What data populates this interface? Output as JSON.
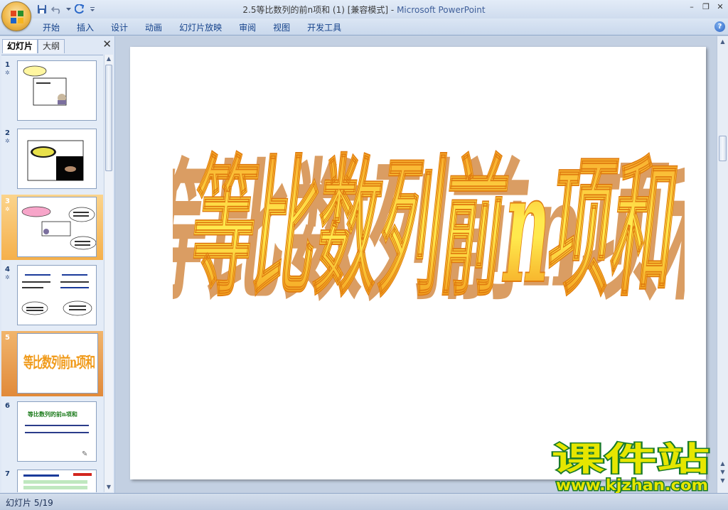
{
  "window": {
    "title_doc": "2.5等比数列的前n项和 (1) [兼容模式] - ",
    "title_app": "Microsoft PowerPoint"
  },
  "quick_access": {
    "icons": [
      "save-icon",
      "undo-icon",
      "redo-icon",
      "customize-icon"
    ]
  },
  "ribbon": {
    "tabs": [
      "开始",
      "插入",
      "设计",
      "动画",
      "幻灯片放映",
      "审阅",
      "视图",
      "开发工具"
    ],
    "help": "?"
  },
  "window_controls": {
    "minimize": "–",
    "restore": "❐",
    "close": "✕"
  },
  "left_pane": {
    "tab_slides": "幻灯片",
    "tab_outline": "大纲",
    "close": "✕",
    "slides": [
      {
        "num": "1"
      },
      {
        "num": "2"
      },
      {
        "num": "3"
      },
      {
        "num": "4"
      },
      {
        "num": "5",
        "title": "等比数列前n项和"
      },
      {
        "num": "6",
        "title": "等比数列的前n项和"
      },
      {
        "num": "7"
      }
    ]
  },
  "slide": {
    "title": "等比数列前n项和"
  },
  "status": {
    "text": "幻灯片 5/19"
  },
  "watermark": {
    "cn": "课件站",
    "url": "www.kjzhan.com"
  },
  "colors": {
    "title_orange": "#f39a1c",
    "title_yellow": "#ffe24a",
    "accent_blue": "#15428b",
    "watermark_green": "#1a7a2a",
    "watermark_yellow": "#e6e600"
  }
}
